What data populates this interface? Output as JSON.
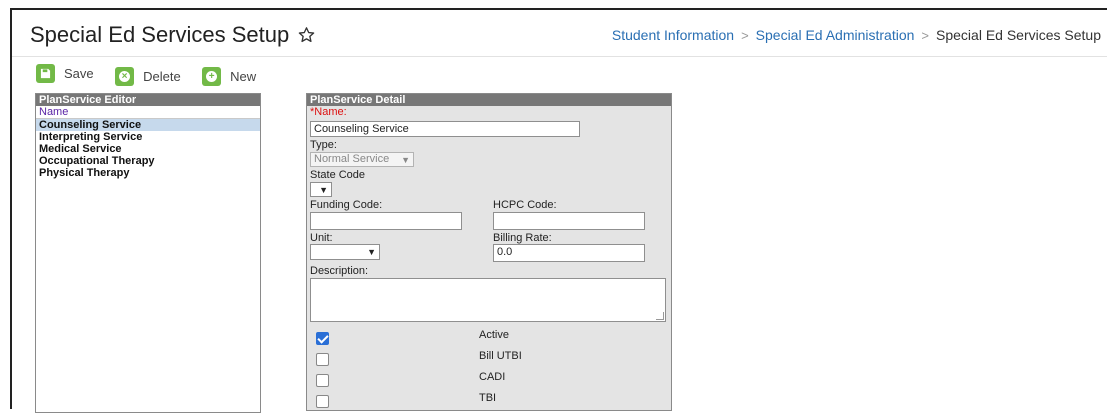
{
  "page": {
    "title": "Special Ed Services Setup",
    "breadcrumb": {
      "items": [
        "Student Information",
        "Special Ed Administration"
      ],
      "current": "Special Ed Services Setup"
    }
  },
  "toolbar": {
    "save_label": "Save",
    "delete_label": "Delete",
    "new_label": "New"
  },
  "editor": {
    "title": "PlanService Editor",
    "column_header": "Name",
    "items": [
      "Counseling Service",
      "Interpreting Service",
      "Medical Service",
      "Occupational Therapy",
      "Physical Therapy"
    ],
    "selected_index": 0
  },
  "detail": {
    "title": "PlanService Detail",
    "name_label": "Name:",
    "name_value": "Counseling Service",
    "type_label": "Type:",
    "type_value": "Normal Service",
    "state_code_label": "State Code",
    "state_code_value": "",
    "funding_code_label": "Funding Code:",
    "funding_code_value": "",
    "hcpc_code_label": "HCPC Code:",
    "hcpc_code_value": "",
    "unit_label": "Unit:",
    "unit_value": "",
    "billing_rate_label": "Billing Rate:",
    "billing_rate_value": "0.0",
    "description_label": "Description:",
    "description_value": "",
    "checkboxes": [
      {
        "label": "Active",
        "checked": true
      },
      {
        "label": "Bill UTBI",
        "checked": false
      },
      {
        "label": "CADI",
        "checked": false
      },
      {
        "label": "TBI",
        "checked": false
      }
    ]
  },
  "colors": {
    "accent_green": "#72b947",
    "link_blue": "#2a6fb3",
    "selected_row": "#c6d9ec",
    "panel_header": "#777777",
    "checkbox_blue": "#2a6fd6"
  },
  "icons": {
    "save": "save-icon",
    "delete": "delete-icon",
    "new": "new-icon",
    "favorite": "star-icon"
  }
}
